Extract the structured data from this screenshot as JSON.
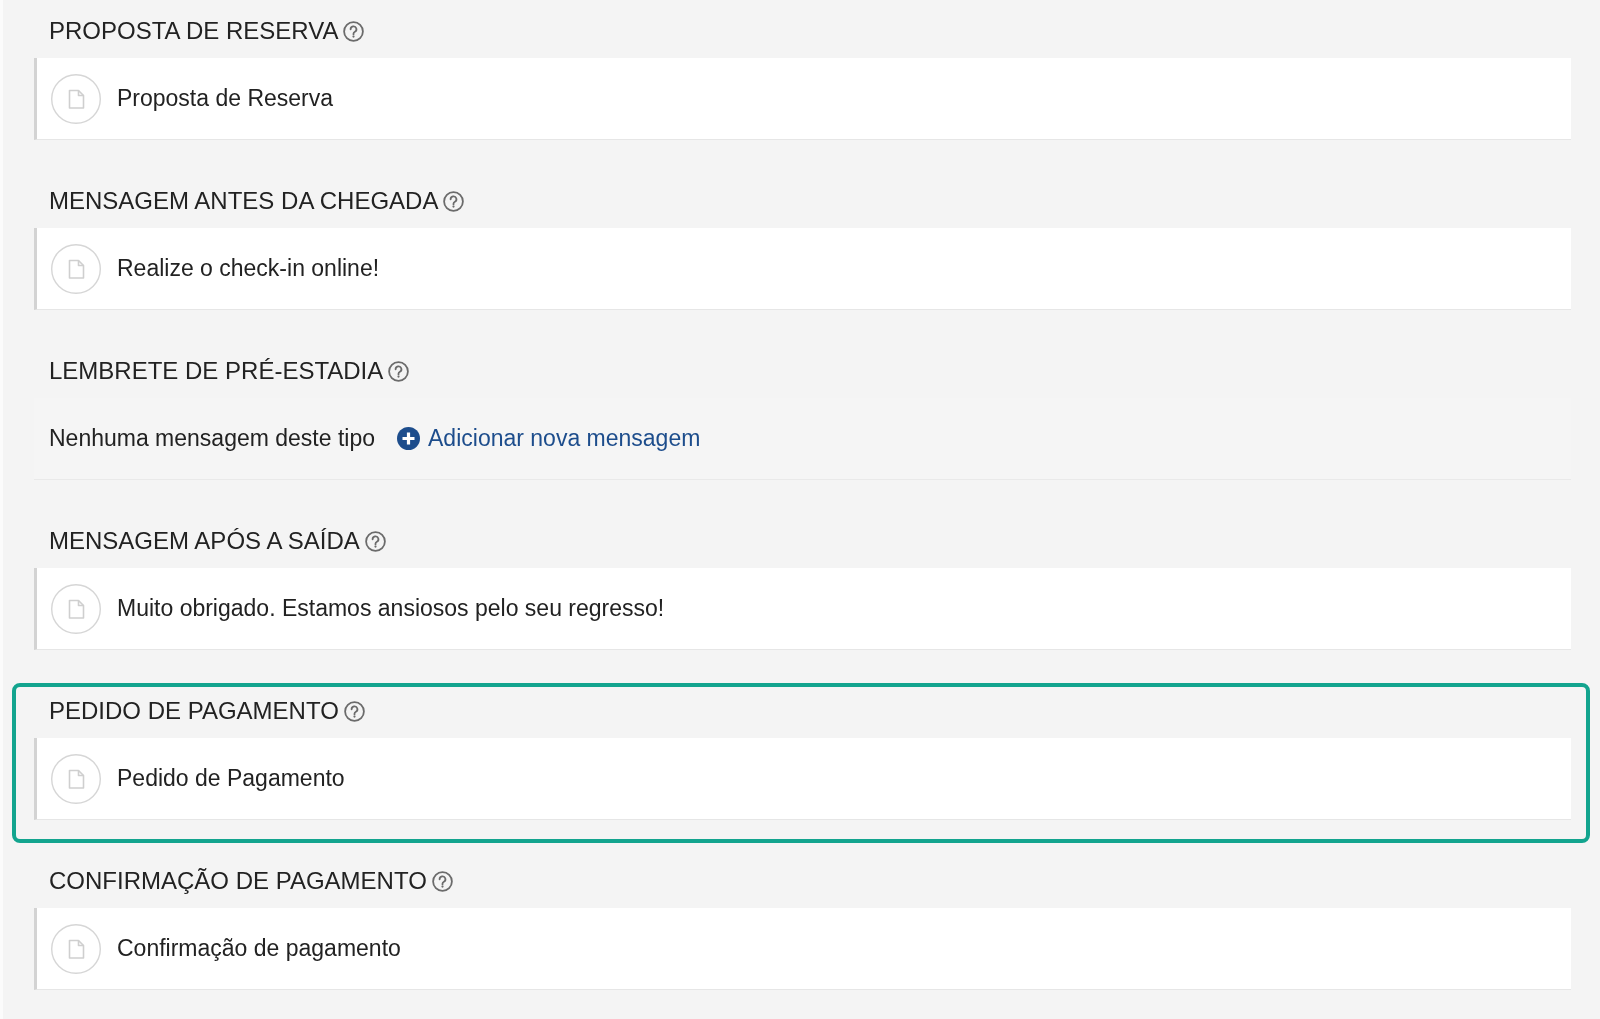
{
  "sections": [
    {
      "title": "PROPOSTA DE RESERVA",
      "highlighted": false,
      "kind": "messages",
      "messages": [
        "Proposta de Reserva"
      ]
    },
    {
      "title": "MENSAGEM ANTES DA CHEGADA",
      "highlighted": false,
      "kind": "messages",
      "messages": [
        "Realize o check-in online!"
      ]
    },
    {
      "title": "LEMBRETE DE PRÉ-ESTADIA",
      "highlighted": false,
      "kind": "empty",
      "empty_text": "Nenhuma mensagem deste tipo",
      "add_link": "Adicionar nova mensagem"
    },
    {
      "title": "MENSAGEM APÓS A SAÍDA",
      "highlighted": false,
      "kind": "messages",
      "messages": [
        "Muito obrigado. Estamos ansiosos pelo seu regresso!"
      ]
    },
    {
      "title": "PEDIDO DE PAGAMENTO",
      "highlighted": true,
      "kind": "messages",
      "messages": [
        "Pedido de Pagamento"
      ]
    },
    {
      "title": "CONFIRMAÇÃO DE PAGAMENTO",
      "highlighted": false,
      "kind": "messages",
      "messages": [
        "Confirmação de pagamento"
      ]
    }
  ]
}
